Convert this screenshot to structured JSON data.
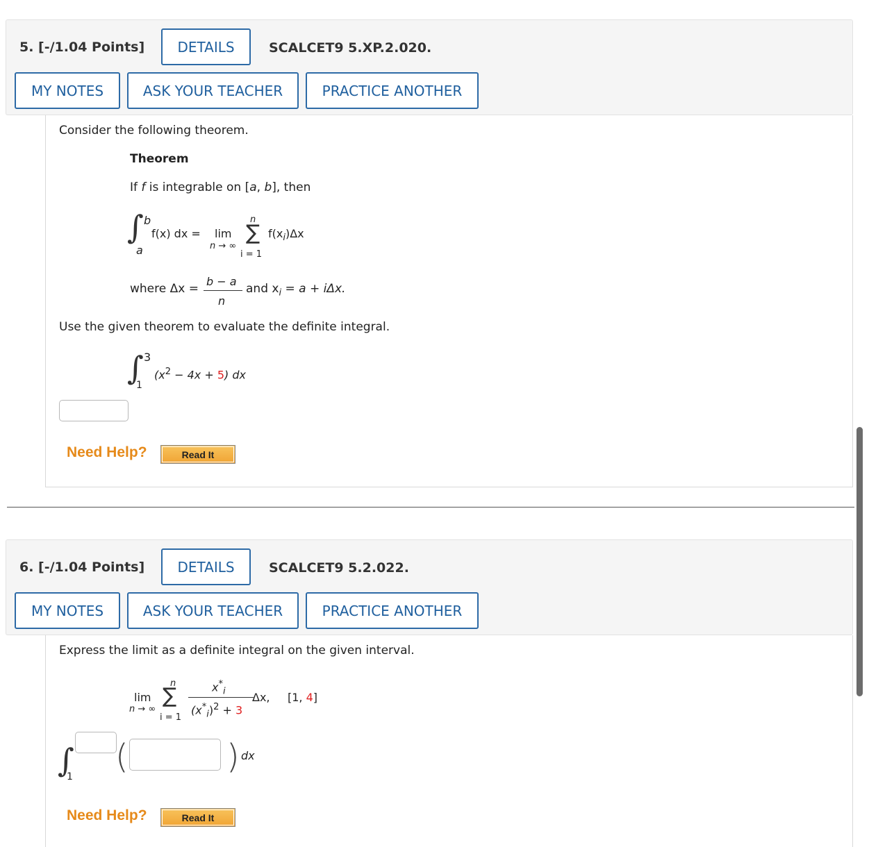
{
  "q5": {
    "points": "5.  [-/1.04 Points]",
    "details": "DETAILS",
    "code": "SCALCET9 5.XP.2.020.",
    "my_notes": "MY NOTES",
    "ask_teacher": "ASK YOUR TEACHER",
    "practice": "PRACTICE ANOTHER",
    "intro": "Consider the following theorem.",
    "theorem_title": "Theorem",
    "theorem_if": "If ",
    "theorem_f": "f",
    "theorem_rest": " is integrable on [",
    "theorem_a": "a",
    "theorem_comma": ", ",
    "theorem_b": "b",
    "theorem_then": "], then",
    "int_upper": "b",
    "int_lower": "a",
    "integrand": "f(x) dx  =",
    "lim": "lim",
    "lim_sub": "n → ∞",
    "sum_top": "n",
    "sum_bottom": "i = 1",
    "sum_body": "f(x",
    "sum_body_sub": "i",
    "sum_body_end": ")Δx",
    "where": "where Δx  =",
    "frac_num": "b − a",
    "frac_den": "n",
    "and_xi": "and x",
    "and_xi_sub": "i",
    "and_xi_rest": " = a + iΔx.",
    "use_given": "Use the given theorem to evaluate the definite integral.",
    "eval_upper": "3",
    "eval_lower": "1",
    "eval_expr_a": "(x",
    "eval_expr_sup": "2",
    "eval_expr_b": " − 4x + ",
    "eval_expr_c": "5",
    "eval_expr_d": ") dx",
    "need_help": "Need Help?",
    "read_it": "Read It"
  },
  "q6": {
    "points": "6.  [-/1.04 Points]",
    "details": "DETAILS",
    "code": "SCALCET9 5.2.022.",
    "my_notes": "MY NOTES",
    "ask_teacher": "ASK YOUR TEACHER",
    "practice": "PRACTICE ANOTHER",
    "intro": "Express the limit as a definite integral on the given interval.",
    "lim": "lim",
    "lim_sub": "n → ∞",
    "sum_top": "n",
    "sum_bottom": "i = 1",
    "frac_num": "x",
    "frac_num_sub": "i",
    "frac_num_sup": "*",
    "frac_den_a": "(x",
    "frac_den_sub": "i",
    "frac_den_sup": "*",
    "frac_den_b": ")",
    "frac_den_sup2": "2",
    "frac_den_c": " + ",
    "frac_den_red": "3",
    "dx": "Δx,",
    "interval_a": "[1, ",
    "interval_red": "4",
    "interval_b": "]",
    "int_lower": "1",
    "int_dx": "dx",
    "need_help": "Need Help?",
    "read_it": "Read It"
  }
}
